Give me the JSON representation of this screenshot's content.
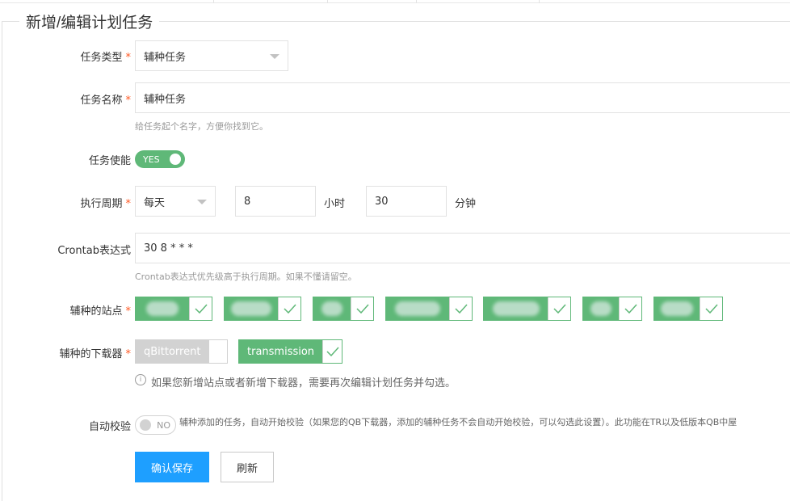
{
  "form": {
    "title": "新增/编辑计划任务",
    "task_type": {
      "label": "任务类型",
      "required": "*",
      "value": "辅种任务"
    },
    "task_name": {
      "label": "任务名称",
      "required": "*",
      "value": "辅种任务",
      "hint": "给任务起个名字，方便你找到它。"
    },
    "task_enable": {
      "label": "任务使能",
      "state": "YES"
    },
    "cycle": {
      "label": "执行周期",
      "required": "*",
      "period": "每天",
      "hour": "8",
      "hour_unit": "小时",
      "minute": "30",
      "minute_unit": "分钟"
    },
    "crontab": {
      "label": "Crontab表达式",
      "value": "30 8 * * *",
      "hint": "Crontab表达式优先级高于执行周期。如果不懂请留空。"
    },
    "sites": {
      "label": "辅种的站点",
      "required": "*",
      "item_count": 7
    },
    "downloaders": {
      "label": "辅种的下载器",
      "required": "*",
      "items": [
        {
          "name": "qBittorrent",
          "checked": false
        },
        {
          "name": "transmission",
          "checked": true
        }
      ],
      "note_icon": "info-icon",
      "note": "如果您新增站点或者新增下载器，需要再次编辑计划任务并勾选。"
    },
    "auto_check": {
      "label": "自动校验",
      "state": "NO",
      "description": "辅种添加的任务，自动开始校验（如果您的QB下载器，添加的辅种任务不会自动开始校验，可以勾选此设置）。此功能在TR以及低版本QB中屋"
    },
    "buttons": {
      "save": "确认保存",
      "refresh": "刷新"
    }
  },
  "colors": {
    "accent_green": "#5fb878",
    "primary_blue": "#1e9fff",
    "required_red": "#ff5722"
  }
}
